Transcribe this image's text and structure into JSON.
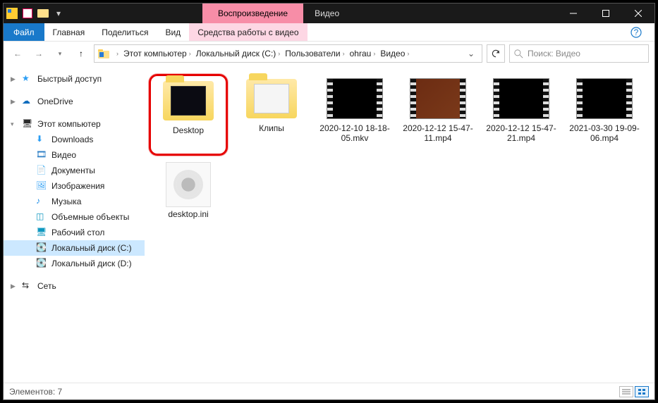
{
  "titlebar": {
    "context_tab": "Воспроизведение",
    "context_header": "Видео"
  },
  "ribbon": {
    "file": "Файл",
    "tabs": [
      "Главная",
      "Поделиться",
      "Вид"
    ],
    "tools_tab": "Средства работы с видео",
    "help": "?"
  },
  "address": {
    "crumbs": [
      "Этот компьютер",
      "Локальный диск (C:)",
      "Пользователи",
      "ohrau",
      "Видео"
    ],
    "search_placeholder": "Поиск: Видео"
  },
  "nav": {
    "quick": "Быстрый доступ",
    "onedrive": "OneDrive",
    "thispc": "Этот компьютер",
    "children": [
      {
        "label": "Downloads",
        "icon": "dl"
      },
      {
        "label": "Видео",
        "icon": "vid"
      },
      {
        "label": "Документы",
        "icon": "doc"
      },
      {
        "label": "Изображения",
        "icon": "img"
      },
      {
        "label": "Музыка",
        "icon": "mus"
      },
      {
        "label": "Объемные объекты",
        "icon": "3d"
      },
      {
        "label": "Рабочий стол",
        "icon": "desk"
      },
      {
        "label": "Локальный диск (C:)",
        "icon": "disk",
        "selected": true
      },
      {
        "label": "Локальный диск (D:)",
        "icon": "disk"
      }
    ],
    "network": "Сеть"
  },
  "items": [
    {
      "name": "Desktop",
      "type": "folder",
      "highlight": true,
      "dark": true
    },
    {
      "name": "Клипы",
      "type": "folder",
      "dark": false
    },
    {
      "name": "2020-12-10 18-18-05.mkv",
      "type": "video"
    },
    {
      "name": "2020-12-12 15-47-11.mp4",
      "type": "video",
      "rich": true
    },
    {
      "name": "2020-12-12 15-47-21.mp4",
      "type": "video"
    },
    {
      "name": "2021-03-30 19-09-06.mp4",
      "type": "video"
    },
    {
      "name": "desktop.ini",
      "type": "ini"
    }
  ],
  "status": {
    "count_label": "Элементов: 7"
  }
}
